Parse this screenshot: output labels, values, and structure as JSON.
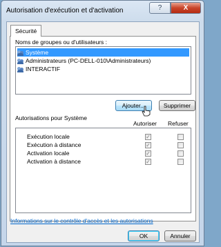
{
  "window": {
    "title": "Autorisation d'exécution et d'activation",
    "help_label": "?",
    "close_label": "X"
  },
  "tabs": [
    {
      "label": "Sécurité"
    }
  ],
  "groups": {
    "label": "Noms de groupes ou d'utilisateurs :",
    "items": [
      {
        "label": "Système",
        "selected": true
      },
      {
        "label": "Administrateurs (PC-DELL-010\\Administrateurs)",
        "selected": false
      },
      {
        "label": "INTERACTIF",
        "selected": false
      }
    ]
  },
  "actions": {
    "add_label": "Ajouter...",
    "remove_label": "Supprimer"
  },
  "permissions": {
    "label": "Autorisations pour Système",
    "allow_header": "Autoriser",
    "deny_header": "Refuser",
    "rows": [
      {
        "label": "Exécution locale",
        "allow": true,
        "deny": false
      },
      {
        "label": "Exécution à distance",
        "allow": true,
        "deny": false
      },
      {
        "label": "Activation locale",
        "allow": true,
        "deny": false
      },
      {
        "label": "Activation à distance",
        "allow": true,
        "deny": false
      }
    ]
  },
  "help_link": "Informations sur le contrôle d'accès et les autorisations",
  "footer": {
    "ok_label": "OK",
    "cancel_label": "Annuler"
  },
  "colors": {
    "selection": "#3399ff",
    "link": "#0066cc",
    "close_button": "#c9452a"
  }
}
